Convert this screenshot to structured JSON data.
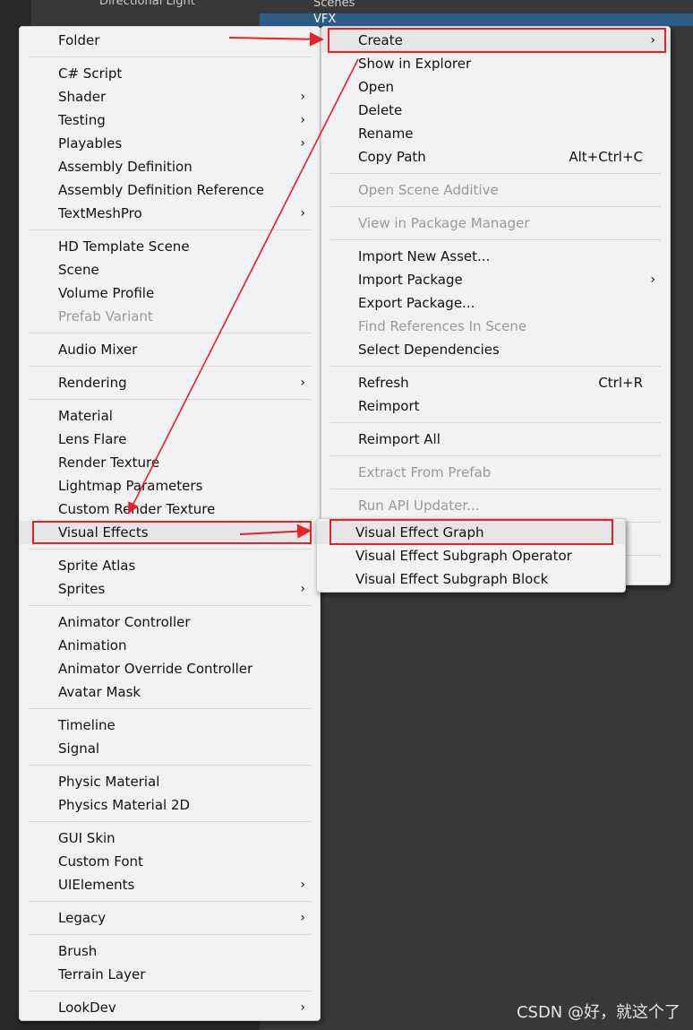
{
  "background": {
    "hierarchy_item": "Directional Light",
    "project_items": [
      "Scenes",
      "VFX"
    ],
    "watermark": "CSDN @好，就这个了"
  },
  "menu_main": [
    {
      "label": "Folder"
    },
    {
      "sep": true
    },
    {
      "label": "C# Script"
    },
    {
      "label": "Shader",
      "submenu": true
    },
    {
      "label": "Testing",
      "submenu": true
    },
    {
      "label": "Playables",
      "submenu": true
    },
    {
      "label": "Assembly Definition"
    },
    {
      "label": "Assembly Definition Reference"
    },
    {
      "label": "TextMeshPro",
      "submenu": true
    },
    {
      "sep": true
    },
    {
      "label": "HD Template Scene"
    },
    {
      "label": "Scene"
    },
    {
      "label": "Volume Profile"
    },
    {
      "label": "Prefab Variant",
      "disabled": true
    },
    {
      "sep": true
    },
    {
      "label": "Audio Mixer"
    },
    {
      "sep": true
    },
    {
      "label": "Rendering",
      "submenu": true
    },
    {
      "sep": true
    },
    {
      "label": "Material"
    },
    {
      "label": "Lens Flare"
    },
    {
      "label": "Render Texture"
    },
    {
      "label": "Lightmap Parameters"
    },
    {
      "label": "Custom Render Texture"
    },
    {
      "label": "Visual Effects",
      "submenu": true,
      "highlighted": true
    },
    {
      "sep": true
    },
    {
      "label": "Sprite Atlas"
    },
    {
      "label": "Sprites",
      "submenu": true
    },
    {
      "sep": true
    },
    {
      "label": "Animator Controller"
    },
    {
      "label": "Animation"
    },
    {
      "label": "Animator Override Controller"
    },
    {
      "label": "Avatar Mask"
    },
    {
      "sep": true
    },
    {
      "label": "Timeline"
    },
    {
      "label": "Signal"
    },
    {
      "sep": true
    },
    {
      "label": "Physic Material"
    },
    {
      "label": "Physics Material 2D"
    },
    {
      "sep": true
    },
    {
      "label": "GUI Skin"
    },
    {
      "label": "Custom Font"
    },
    {
      "label": "UIElements",
      "submenu": true
    },
    {
      "sep": true
    },
    {
      "label": "Legacy",
      "submenu": true
    },
    {
      "sep": true
    },
    {
      "label": "Brush"
    },
    {
      "label": "Terrain Layer"
    },
    {
      "sep": true
    },
    {
      "label": "LookDev",
      "submenu": true
    }
  ],
  "menu_context": [
    {
      "label": "Create",
      "submenu": true,
      "highlighted": true
    },
    {
      "label": "Show in Explorer"
    },
    {
      "label": "Open"
    },
    {
      "label": "Delete"
    },
    {
      "label": "Rename"
    },
    {
      "label": "Copy Path",
      "shortcut": "Alt+Ctrl+C"
    },
    {
      "sep": true
    },
    {
      "label": "Open Scene Additive",
      "disabled": true
    },
    {
      "sep": true
    },
    {
      "label": "View in Package Manager",
      "disabled": true
    },
    {
      "sep": true
    },
    {
      "label": "Import New Asset..."
    },
    {
      "label": "Import Package",
      "submenu": true
    },
    {
      "label": "Export Package..."
    },
    {
      "label": "Find References In Scene",
      "disabled": true
    },
    {
      "label": "Select Dependencies"
    },
    {
      "sep": true
    },
    {
      "label": "Refresh",
      "shortcut": "Ctrl+R"
    },
    {
      "label": "Reimport"
    },
    {
      "sep": true
    },
    {
      "label": "Reimport All"
    },
    {
      "sep": true
    },
    {
      "label": "Extract From Prefab",
      "disabled": true
    },
    {
      "sep": true
    },
    {
      "label": "Run API Updater...",
      "disabled": true
    },
    {
      "sep": true
    },
    {
      "label": ""
    },
    {
      "sep": true
    },
    {
      "label": ""
    }
  ],
  "menu_vfx": [
    {
      "label": "Visual Effect Graph",
      "highlighted": true
    },
    {
      "label": "Visual Effect Subgraph Operator"
    },
    {
      "label": "Visual Effect Subgraph Block"
    }
  ],
  "colors": {
    "annotation": "#e8202a",
    "selection": "#2c5d87"
  }
}
